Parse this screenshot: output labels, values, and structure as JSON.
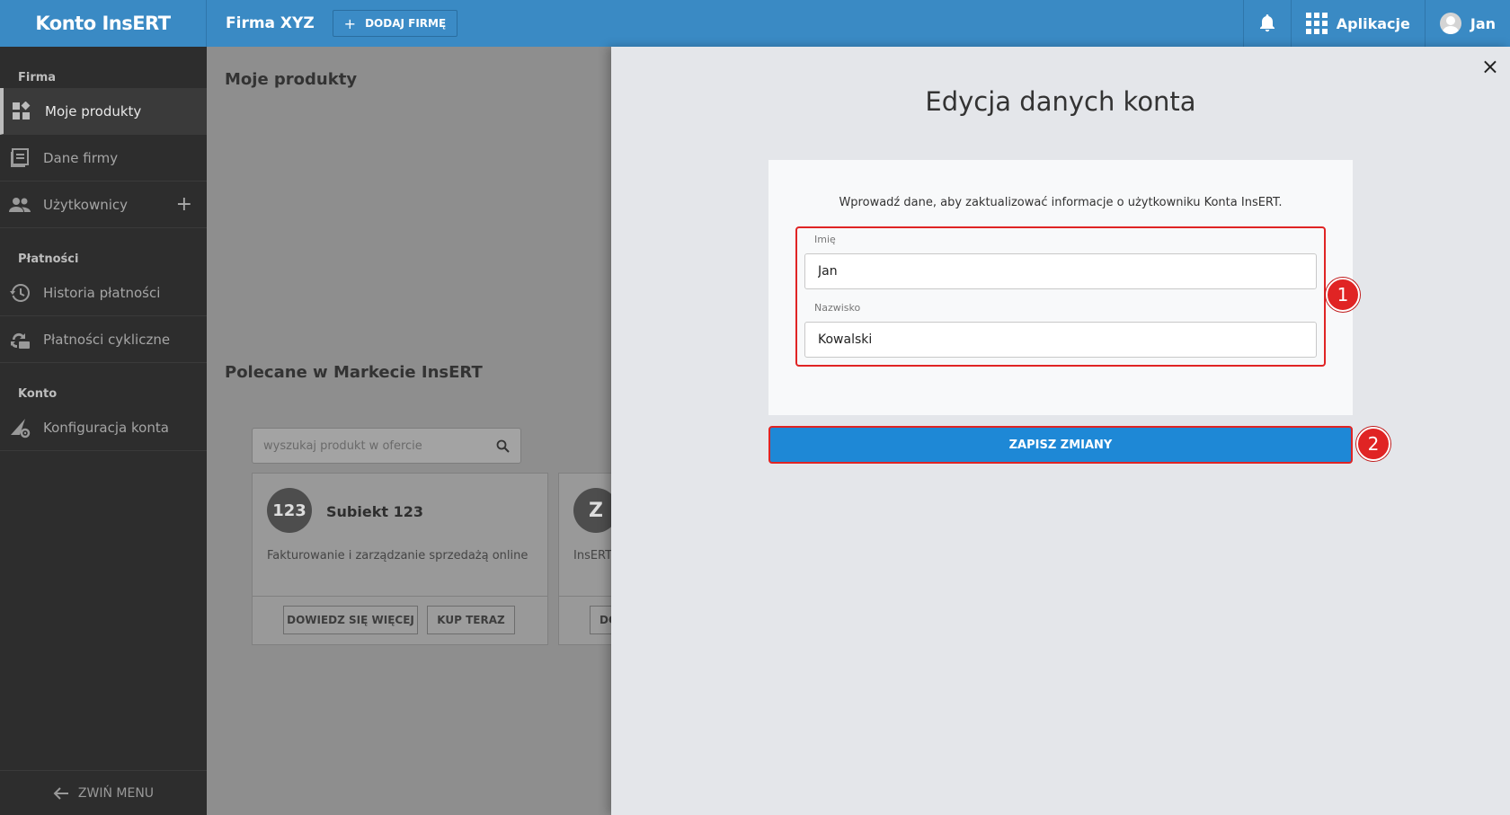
{
  "topbar": {
    "brand": "Konto InsERT",
    "company": "Firma XYZ",
    "add_company": "DODAJ FIRMĘ",
    "apps": "Aplikacje",
    "user": "Jan"
  },
  "sidebar": {
    "sections": [
      {
        "title": "Firma",
        "items": [
          "Moje produkty",
          "Dane firmy",
          "Użytkownicy"
        ]
      },
      {
        "title": "Płatności",
        "items": [
          "Historia płatności",
          "Płatności cykliczne"
        ]
      },
      {
        "title": "Konto",
        "items": [
          "Konfiguracja konta"
        ]
      }
    ],
    "collapse": "ZWIŃ MENU"
  },
  "main": {
    "title": "Moje produkty",
    "recommended_title": "Polecane w Markecie InsERT",
    "search_placeholder": "wyszukaj produkt w ofercie",
    "cards": [
      {
        "logo": "123",
        "name": "Subiekt 123",
        "desc": "Fakturowanie i zarządzanie sprzedażą online",
        "btn_more": "DOWIEDZ SIĘ WIĘCEJ",
        "btn_buy": "KUP TERAZ"
      },
      {
        "logo": "Z",
        "desc": "InsERT",
        "btn_more": "DO"
      }
    ]
  },
  "panel": {
    "title": "Edycja danych konta",
    "intro": "Wprowadź dane, aby zaktualizować informacje o użytkowniku Konta InsERT.",
    "first_name_label": "Imię",
    "first_name_value": "Jan",
    "last_name_label": "Nazwisko",
    "last_name_value": "Kowalski",
    "save": "ZAPISZ ZMIANY",
    "close": "×",
    "markers": [
      "1",
      "2"
    ]
  }
}
